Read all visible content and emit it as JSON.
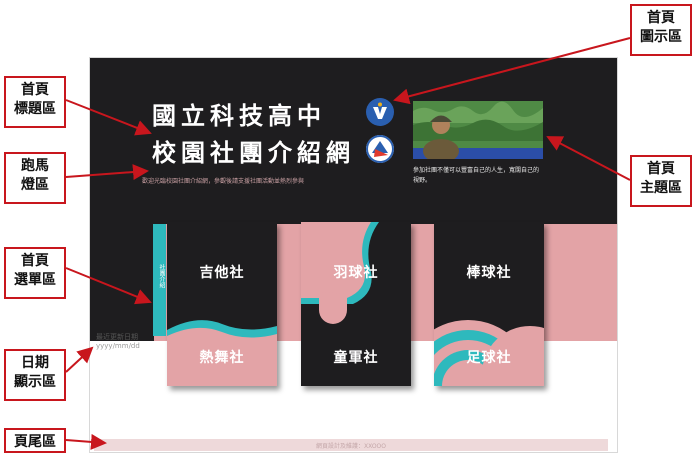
{
  "hero": {
    "title_line1": "國立科技高中",
    "title_line2": "校園社團介紹網",
    "marquee": "歡迎光臨校園社團介紹網，參觀後請支援社團活動並熱烈參與",
    "theme_text": "參加社團不僅可以豐富自己的人生，寬闊自己的視野。"
  },
  "menu": {
    "tab_label": "社團介紹",
    "cards": [
      {
        "top": "吉他社",
        "bottom": "熱舞社"
      },
      {
        "top": "羽球社",
        "bottom": "童軍社"
      },
      {
        "top": "棒球社",
        "bottom": "足球社"
      }
    ]
  },
  "date": {
    "label": "最近更新日期",
    "value": "yyyy/mm/dd"
  },
  "footer": {
    "text": "網頁設計及維護：XXOOO"
  },
  "callouts": {
    "icon": [
      "首頁",
      "圖示區"
    ],
    "title": [
      "首頁",
      "標題區"
    ],
    "marquee": [
      "跑馬",
      "燈區"
    ],
    "theme": [
      "首頁",
      "主題區"
    ],
    "menu": [
      "首頁",
      "選單區"
    ],
    "date": [
      "日期",
      "顯示區"
    ],
    "footer": [
      "頁尾區"
    ]
  },
  "colors": {
    "hero_bg": "#1e1d1f",
    "pink": "#e3a3a6",
    "teal": "#2eb9bd",
    "callout_border": "#c8161d"
  }
}
